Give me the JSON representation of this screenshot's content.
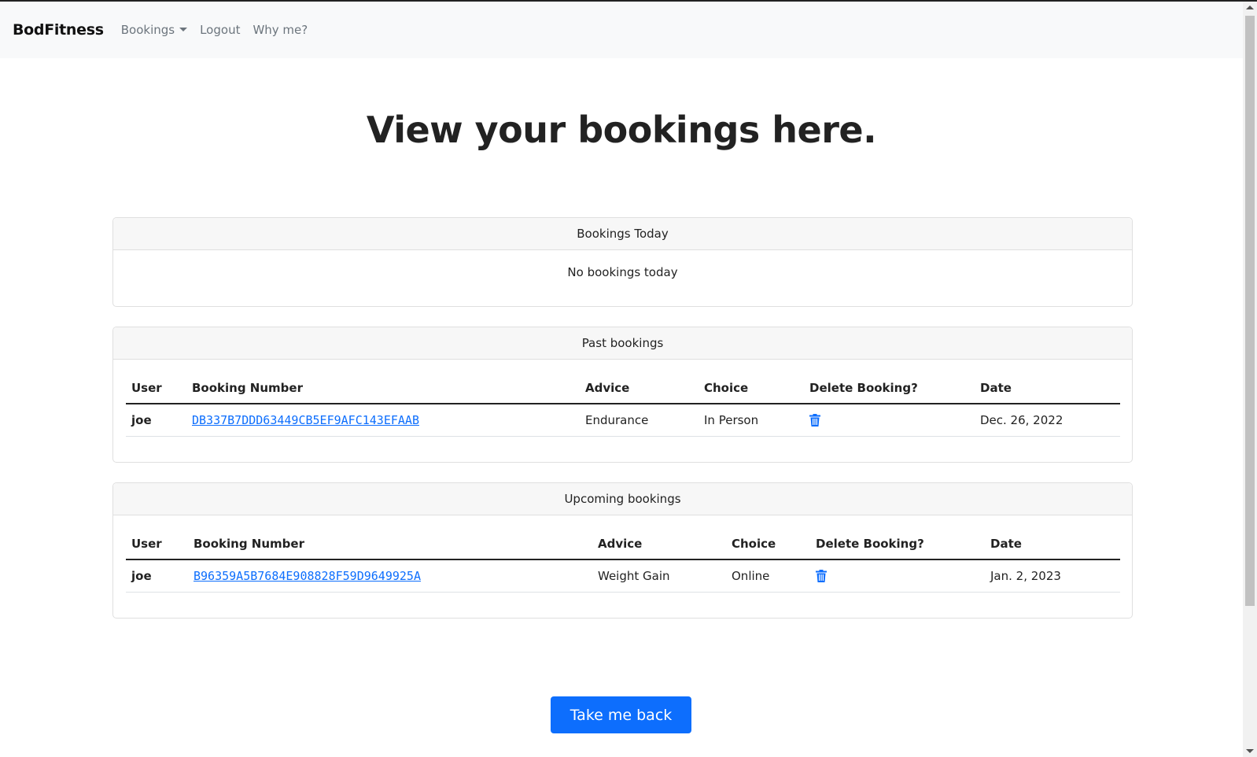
{
  "navbar": {
    "brand": "BodFitness",
    "links": {
      "bookings": "Bookings",
      "logout": "Logout",
      "why_me": "Why me?"
    }
  },
  "page": {
    "title": "View your bookings here."
  },
  "today": {
    "header": "Bookings Today",
    "empty_message": "No bookings today"
  },
  "past": {
    "header": "Past bookings",
    "columns": [
      "User",
      "Booking Number",
      "Advice",
      "Choice",
      "Delete Booking?",
      "Date"
    ],
    "rows": [
      {
        "user": "joe",
        "booking_number": "DB337B7DDD63449CB5EF9AFC143EFAAB",
        "advice": "Endurance",
        "choice": "In Person",
        "delete_icon": "trash-icon",
        "date": "Dec. 26, 2022"
      }
    ]
  },
  "upcoming": {
    "header": "Upcoming bookings",
    "columns": [
      "User",
      "Booking Number",
      "Advice",
      "Choice",
      "Delete Booking?",
      "Date"
    ],
    "rows": [
      {
        "user": "joe",
        "booking_number": "B96359A5B7684E908828F59D9649925A",
        "advice": "Weight Gain",
        "choice": "Online",
        "delete_icon": "trash-icon",
        "date": "Jan. 2, 2023"
      }
    ]
  },
  "back_button": {
    "label": "Take me back"
  },
  "colors": {
    "link": "#0d6efd",
    "button": "#0d6efd",
    "navbar_bg": "#f8f9fa"
  }
}
